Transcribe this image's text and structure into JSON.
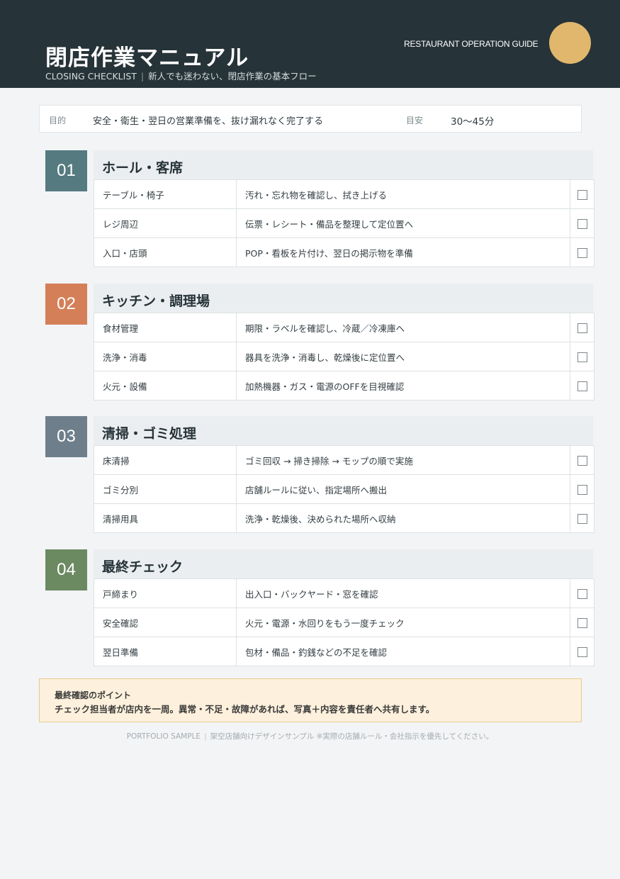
{
  "header": {
    "title": "閉店作業マニュアル",
    "subtitle_en": "CLOSING CHECKLIST",
    "subtitle_sep": "|",
    "subtitle_jp": "新人でも迷わない、閉店作業の基本フロー",
    "guide": "RESTAURANT OPERATION GUIDE",
    "accent_color": "#e0b76d",
    "bg_color": "#263338"
  },
  "purpose": {
    "label": "目的",
    "text": "安全・衛生・翌日の営業準備を、抜け漏れなく完了する",
    "time_label": "目安",
    "time_value": "30〜45分"
  },
  "sections": [
    {
      "number": "01",
      "title": "ホール・客席",
      "color": "#557a80",
      "items": [
        {
          "area": "テーブル・椅子",
          "task": "汚れ・忘れ物を確認し、拭き上げる",
          "checked": false
        },
        {
          "area": "レジ周辺",
          "task": "伝票・レシート・備品を整理して定位置へ",
          "checked": false
        },
        {
          "area": "入口・店頭",
          "task": "POP・看板を片付け、翌日の掲示物を準備",
          "checked": false
        }
      ]
    },
    {
      "number": "02",
      "title": "キッチン・調理場",
      "color": "#d47f57",
      "items": [
        {
          "area": "食材管理",
          "task": "期限・ラベルを確認し、冷蔵／冷凍庫へ",
          "checked": false
        },
        {
          "area": "洗浄・消毒",
          "task": "器具を洗浄・消毒し、乾燥後に定位置へ",
          "checked": false
        },
        {
          "area": "火元・設備",
          "task": "加熱機器・ガス・電源のOFFを目視確認",
          "checked": false
        }
      ]
    },
    {
      "number": "03",
      "title": "清掃・ゴミ処理",
      "color": "#6e7f8b",
      "items": [
        {
          "area": "床清掃",
          "task": "ゴミ回収 → 掃き掃除 → モップの順で実施",
          "checked": false
        },
        {
          "area": "ゴミ分別",
          "task": "店舗ルールに従い、指定場所へ搬出",
          "checked": false
        },
        {
          "area": "清掃用具",
          "task": "洗浄・乾燥後、決められた場所へ収納",
          "checked": false
        }
      ]
    },
    {
      "number": "04",
      "title": "最終チェック",
      "color": "#6c8a61",
      "items": [
        {
          "area": "戸締まり",
          "task": "出入口・バックヤード・窓を確認",
          "checked": false
        },
        {
          "area": "安全確認",
          "task": "火元・電源・水回りをもう一度チェック",
          "checked": false
        },
        {
          "area": "翌日準備",
          "task": "包材・備品・釣銭などの不足を確認",
          "checked": false
        }
      ]
    }
  ],
  "note": {
    "title": "最終確認のポイント",
    "body": "チェック担当者が店内を一周。異常・不足・故障があれば、写真＋内容を責任者へ共有します。"
  },
  "footer": {
    "left": "PORTFOLIO SAMPLE",
    "sep": "|",
    "right": "架空店舗向けデザインサンプル ※実際の店舗ルール・会社指示を優先してください。"
  }
}
